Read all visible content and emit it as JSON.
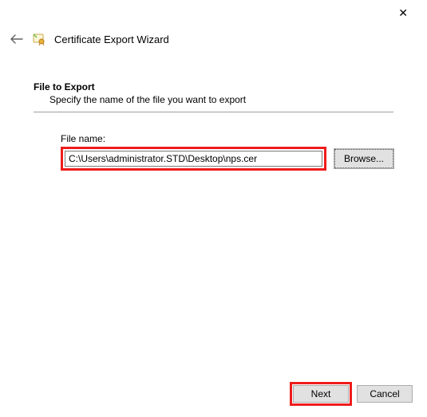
{
  "titlebar": {
    "close": "✕"
  },
  "header": {
    "back_arrow": "←",
    "wizard_title": "Certificate Export Wizard"
  },
  "section": {
    "heading": "File to Export",
    "subtext": "Specify the name of the file you want to export"
  },
  "filename": {
    "label": "File name:",
    "value": "C:\\Users\\administrator.STD\\Desktop\\nps.cer",
    "browse": "Browse..."
  },
  "footer": {
    "next": "Next",
    "cancel": "Cancel"
  }
}
